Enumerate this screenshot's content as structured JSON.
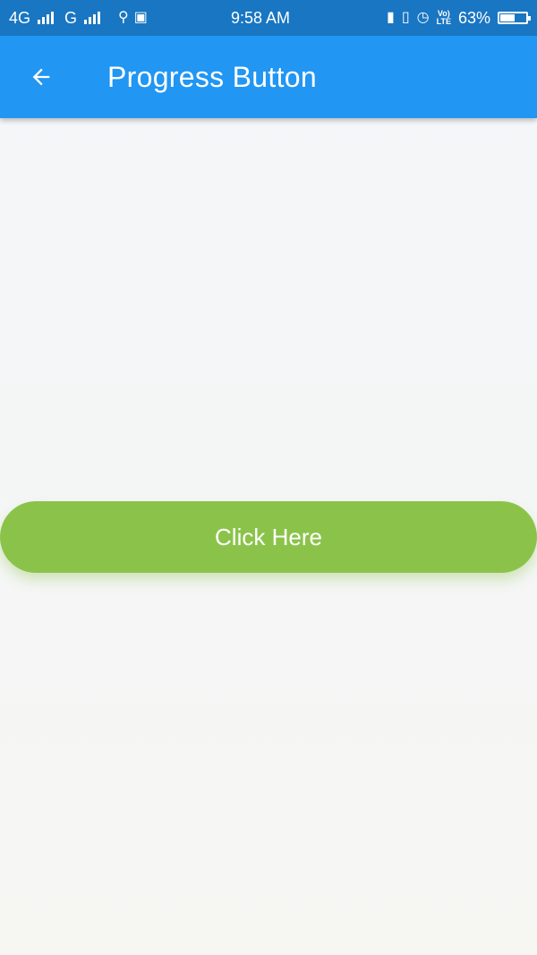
{
  "status_bar": {
    "network_1": "4G",
    "network_2": "G",
    "time": "9:58 AM",
    "volte_top": "Vo)",
    "volte_bottom": "LTE",
    "battery_percent": "63%",
    "battery_level": 0.63
  },
  "app_bar": {
    "title": "Progress Button",
    "back_icon": "arrow-left-icon"
  },
  "progress_button": {
    "label": "Click Here",
    "color": "#8bc34a"
  },
  "colors": {
    "status_bar": "#1976c2",
    "app_bar": "#2196f3",
    "background": "#f4f6f7"
  }
}
